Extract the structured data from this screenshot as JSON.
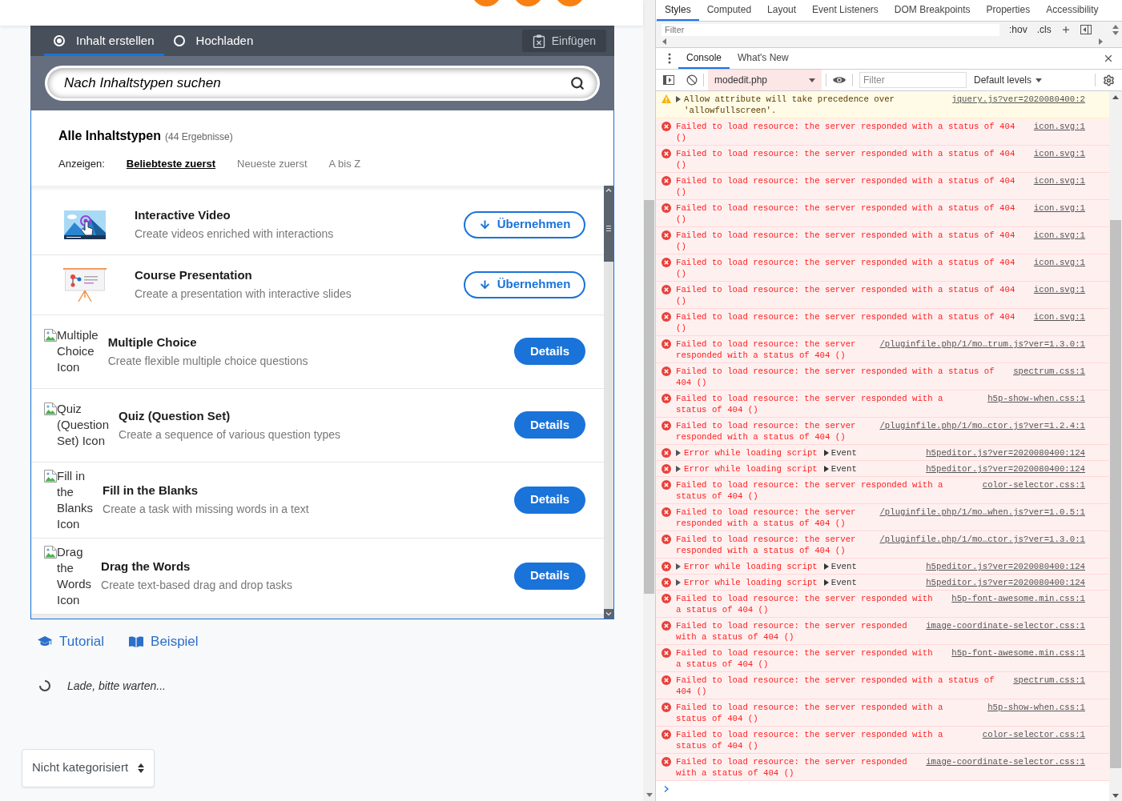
{
  "page": {
    "hub": {
      "tabs": [
        {
          "label": "Inhalt erstellen",
          "selected": true
        },
        {
          "label": "Hochladen",
          "selected": false
        }
      ],
      "paste_button": "Einfügen",
      "search": {
        "placeholder": "Nach Inhaltstypen suchen"
      },
      "results": {
        "title": "Alle Inhaltstypen",
        "count": "(44 Ergebnisse)"
      },
      "sort": {
        "label": "Anzeigen:",
        "options": [
          {
            "label": "Beliebteste zuerst",
            "selected": true
          },
          {
            "label": "Neueste zuerst",
            "selected": false
          },
          {
            "label": "A bis Z",
            "selected": false
          }
        ]
      },
      "content_types": [
        {
          "kind": "installed",
          "title": "Interactive Video",
          "description": "Create videos enriched with interactions",
          "action": "Übernehmen"
        },
        {
          "kind": "installed",
          "title": "Course Presentation",
          "description": "Create a presentation with interactive slides",
          "action": "Übernehmen"
        },
        {
          "kind": "available",
          "image_alt": "Multiple Choice Icon",
          "title": "Multiple Choice",
          "description": "Create flexible multiple choice questions",
          "action": "Details"
        },
        {
          "kind": "available",
          "image_alt": "Quiz (Question Set) Icon",
          "title": "Quiz (Question Set)",
          "description": "Create a sequence of various question types",
          "action": "Details"
        },
        {
          "kind": "available",
          "image_alt": "Fill in the Blanks Icon",
          "title": "Fill in the Blanks",
          "description": "Create a task with missing words in a text",
          "action": "Details"
        },
        {
          "kind": "available",
          "image_alt": "Drag the Words Icon",
          "title": "Drag the Words",
          "description": "Create text-based drag and drop tasks",
          "action": "Details"
        }
      ]
    },
    "links": [
      {
        "label": "Tutorial"
      },
      {
        "label": "Beispiel"
      }
    ],
    "loading": "Lade, bitte warten...",
    "category_select": {
      "value": "Nicht kategorisiert"
    }
  },
  "devtools": {
    "sidebar_tabs": [
      {
        "label": "Styles",
        "selected": true
      },
      {
        "label": "Computed",
        "selected": false
      },
      {
        "label": "Layout",
        "selected": false
      },
      {
        "label": "Event Listeners",
        "selected": false
      },
      {
        "label": "DOM Breakpoints",
        "selected": false
      },
      {
        "label": "Properties",
        "selected": false
      },
      {
        "label": "Accessibility",
        "selected": false
      }
    ],
    "styles_filter": {
      "placeholder": "Filter"
    },
    "style_buttons": [
      ":hov",
      ".cls"
    ],
    "drawer_tabs": [
      {
        "label": "Console",
        "selected": true
      },
      {
        "label": "What's New",
        "selected": false
      }
    ],
    "console_toolbar": {
      "context": "modedit.php",
      "filter": {
        "placeholder": "Filter"
      },
      "levels": "Default levels"
    },
    "messages": [
      {
        "kind": "warning",
        "expandable": true,
        "text": "Allow attribute will take precedence over 'allowfullscreen'.",
        "source": "jquery.js?ver=2020080400:2"
      },
      {
        "kind": "error",
        "expandable": false,
        "text": "Failed to load resource: the server responded with a status of 404 ()",
        "source": "icon.svg:1"
      },
      {
        "kind": "error",
        "expandable": false,
        "text": "Failed to load resource: the server responded with a status of 404 ()",
        "source": "icon.svg:1"
      },
      {
        "kind": "error",
        "expandable": false,
        "text": "Failed to load resource: the server responded with a status of 404 ()",
        "source": "icon.svg:1"
      },
      {
        "kind": "error",
        "expandable": false,
        "text": "Failed to load resource: the server responded with a status of 404 ()",
        "source": "icon.svg:1"
      },
      {
        "kind": "error",
        "expandable": false,
        "text": "Failed to load resource: the server responded with a status of 404 ()",
        "source": "icon.svg:1"
      },
      {
        "kind": "error",
        "expandable": false,
        "text": "Failed to load resource: the server responded with a status of 404 ()",
        "source": "icon.svg:1"
      },
      {
        "kind": "error",
        "expandable": false,
        "text": "Failed to load resource: the server responded with a status of 404 ()",
        "source": "icon.svg:1"
      },
      {
        "kind": "error",
        "expandable": false,
        "text": "Failed to load resource: the server responded with a status of 404 ()",
        "source": "icon.svg:1"
      },
      {
        "kind": "error",
        "expandable": false,
        "text": "Failed to load resource: the server responded with a status of 404 ()",
        "source": "/pluginfile.php/1/mo…trum.js?ver=1.3.0:1"
      },
      {
        "kind": "error",
        "expandable": false,
        "text": "Failed to load resource: the server responded with a status of 404 ()",
        "source": "spectrum.css:1"
      },
      {
        "kind": "error",
        "expandable": false,
        "text": "Failed to load resource: the server responded with a status of 404 ()",
        "source": "h5p-show-when.css:1"
      },
      {
        "kind": "error",
        "expandable": false,
        "text": "Failed to load resource: the server responded with a status of 404 ()",
        "source": "/pluginfile.php/1/mo…ctor.js?ver=1.2.4:1"
      },
      {
        "kind": "error",
        "expandable": true,
        "text": "Error while loading script",
        "detail": "Event",
        "source": "h5peditor.js?ver=2020080400:124"
      },
      {
        "kind": "error",
        "expandable": true,
        "text": "Error while loading script",
        "detail": "Event",
        "source": "h5peditor.js?ver=2020080400:124"
      },
      {
        "kind": "error",
        "expandable": false,
        "text": "Failed to load resource: the server responded with a status of 404 ()",
        "source": "color-selector.css:1"
      },
      {
        "kind": "error",
        "expandable": false,
        "text": "Failed to load resource: the server responded with a status of 404 ()",
        "source": "/pluginfile.php/1/mo…when.js?ver=1.0.5:1"
      },
      {
        "kind": "error",
        "expandable": false,
        "text": "Failed to load resource: the server responded with a status of 404 ()",
        "source": "/pluginfile.php/1/mo…ctor.js?ver=1.3.0:1"
      },
      {
        "kind": "error",
        "expandable": true,
        "text": "Error while loading script",
        "detail": "Event",
        "source": "h5peditor.js?ver=2020080400:124"
      },
      {
        "kind": "error",
        "expandable": true,
        "text": "Error while loading script",
        "detail": "Event",
        "source": "h5peditor.js?ver=2020080400:124"
      },
      {
        "kind": "error",
        "expandable": false,
        "text": "Failed to load resource: the server responded with a status of 404 ()",
        "source": "h5p-font-awesome.min.css:1"
      },
      {
        "kind": "error",
        "expandable": false,
        "text": "Failed to load resource: the server responded with a status of 404 ()",
        "source": "image-coordinate-selector.css:1"
      },
      {
        "kind": "error",
        "expandable": false,
        "text": "Failed to load resource: the server responded with a status of 404 ()",
        "source": "h5p-font-awesome.min.css:1"
      },
      {
        "kind": "error",
        "expandable": false,
        "text": "Failed to load resource: the server responded with a status of 404 ()",
        "source": "spectrum.css:1"
      },
      {
        "kind": "error",
        "expandable": false,
        "text": "Failed to load resource: the server responded with a status of 404 ()",
        "source": "h5p-show-when.css:1"
      },
      {
        "kind": "error",
        "expandable": false,
        "text": "Failed to load resource: the server responded with a status of 404 ()",
        "source": "color-selector.css:1"
      },
      {
        "kind": "error",
        "expandable": false,
        "text": "Failed to load resource: the server responded with a status of 404 ()",
        "source": "image-coordinate-selector.css:1"
      }
    ]
  }
}
